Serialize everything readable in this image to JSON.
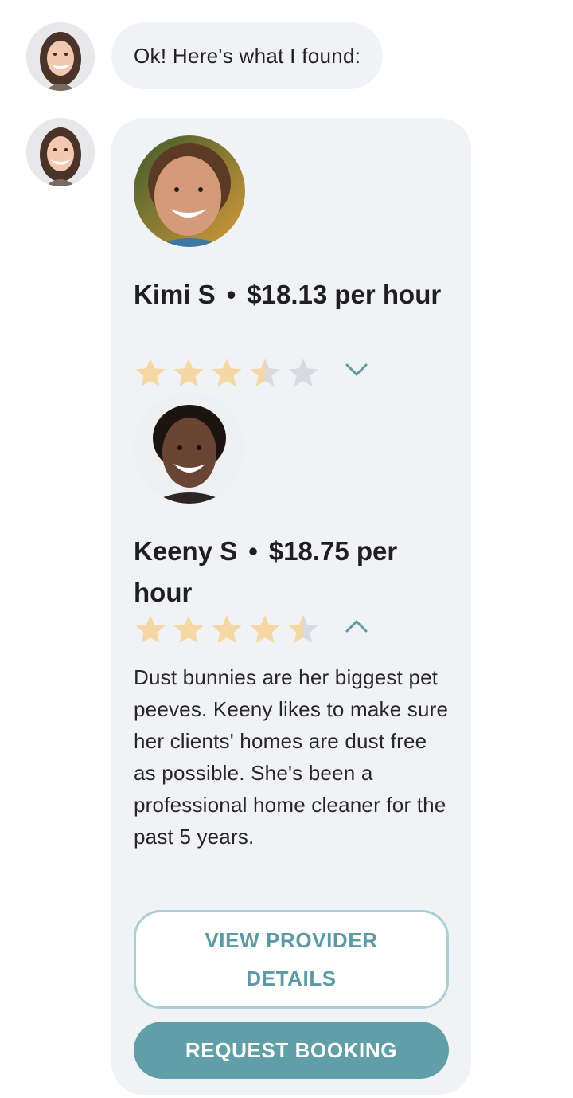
{
  "assistant": {
    "greeting": "Ok! Here's what I found:"
  },
  "providers": [
    {
      "name": "Kimi S",
      "separator": "•",
      "rate": "$18.13 per hour",
      "rating": 3.5,
      "expanded": false
    },
    {
      "name": "Keeny S",
      "separator": "•",
      "rate": "$18.75 per hour",
      "rating": 4.5,
      "expanded": true,
      "bio": "Dust bunnies are her biggest pet peeves. Keeny likes to make sure her clients' homes are dust free as possible. She's been a professional home cleaner for the past 5 years."
    }
  ],
  "actions": {
    "view_details": "VIEW PROVIDER DETAILS",
    "request_booking": "REQUEST BOOKING"
  },
  "icons": {
    "star_filled": "star-icon",
    "chevron_down": "chevron-down-icon",
    "chevron_up": "chevron-up-icon"
  },
  "colors": {
    "star_filled": "#f5d7a3",
    "star_empty": "#d9dadf",
    "accent": "#609ea8",
    "accent_light": "#a9cfd5",
    "bubble_bg": "#f1f2f6"
  }
}
